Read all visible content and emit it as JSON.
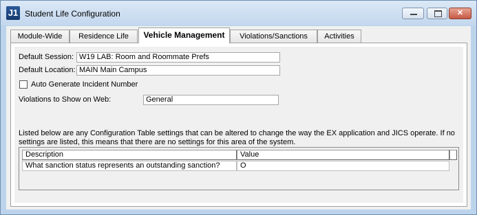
{
  "window": {
    "app_icon_text": "J1",
    "title": "Student Life Configuration",
    "controls": {
      "minimize": "–",
      "maximize": "□",
      "close": "✕"
    }
  },
  "tabs": [
    {
      "label": "Module-Wide",
      "active": false
    },
    {
      "label": "Residence Life",
      "active": false
    },
    {
      "label": "Vehicle Management",
      "active": true
    },
    {
      "label": "Violations/Sanctions",
      "active": false
    },
    {
      "label": "Activities",
      "active": false
    }
  ],
  "form": {
    "default_session_label": "Default Session:",
    "default_session_value": "W19   LAB: Room and Roommate Prefs",
    "default_location_label": "Default Location:",
    "default_location_value": "MAIN   Main Campus",
    "auto_generate_label": "Auto Generate Incident Number",
    "auto_generate_checked": false,
    "violations_web_label": "Violations to Show on Web:",
    "violations_web_value": "General"
  },
  "note": "Listed below are any Configuration Table settings that can be altered to change the way the EX application and JICS operate.  If no settings are listed, this means that there are no settings for this area of the system.",
  "table": {
    "columns": [
      "Description",
      "Value"
    ],
    "rows": [
      {
        "description": "What sanction status represents an outstanding sanction?",
        "value": "O"
      }
    ]
  }
}
